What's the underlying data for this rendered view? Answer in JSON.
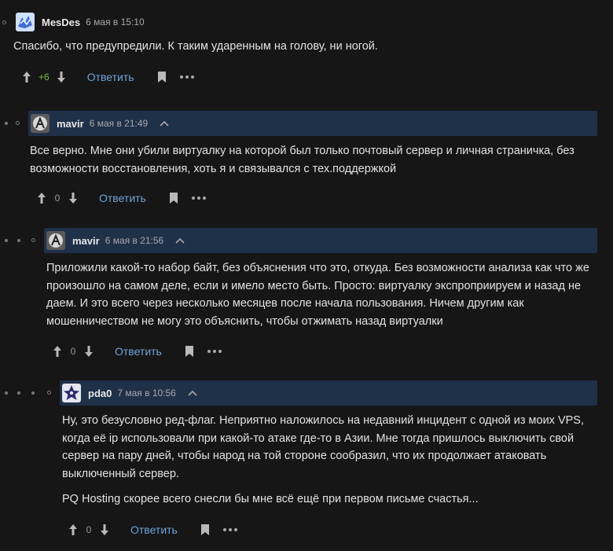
{
  "comments": [
    {
      "username": "MesDes",
      "time": "6 мая в 15:10",
      "paragraphs": [
        "Спасибо, что предупредили. К таким ударенным на голову, ни ногой."
      ],
      "score": "+6",
      "reply_label": "Ответить",
      "avatar_icon": "avatar-mesdes-icon"
    },
    {
      "username": "mavir",
      "time": "6 мая в 21:49",
      "paragraphs": [
        "Все верно. Мне они убили виртуалку на которой был только почтовый сервер и личная страничка, без возможности восстановления, хоть я и связывался с тех.поддержкой"
      ],
      "score": "0",
      "reply_label": "Ответить",
      "avatar_icon": "avatar-mavir-icon"
    },
    {
      "username": "mavir",
      "time": "6 мая в 21:56",
      "paragraphs": [
        "Приложили какой-то набор байт, без объяснения что это, откуда. Без возможности анализа как что же произошло на самом деле, если и имело место быть. Просто: виртуалку экспроприируем и назад не даем. И это всего через несколько месяцев после начала пользования. Ничем другим как мошенничеством не могу это объяснить, чтобы отжимать назад виртуалки"
      ],
      "score": "0",
      "reply_label": "Ответить",
      "avatar_icon": "avatar-mavir-icon"
    },
    {
      "username": "pda0",
      "time": "7 мая в 10:56",
      "paragraphs": [
        "Ну, это безусловно ред-флаг. Неприятно наложилось на недавний инцидент с одной из моих VPS, когда её ip использовали при какой-то атаке где-то в Азии. Мне тогда пришлось выключить свой сервер на пару дней, чтобы народ на той стороне сообразил, что их продолжает атаковать выключенный сервер.",
        "PQ Hosting скорее всего снесли бы мне всё ещё при первом письме счастья..."
      ],
      "score": "0",
      "reply_label": "Ответить",
      "avatar_icon": "avatar-pda0-icon"
    }
  ],
  "colors": {
    "background": "#161616",
    "highlight_header": "#1f3049",
    "link": "#6fa3d8",
    "positive_score": "#7cba3b"
  }
}
